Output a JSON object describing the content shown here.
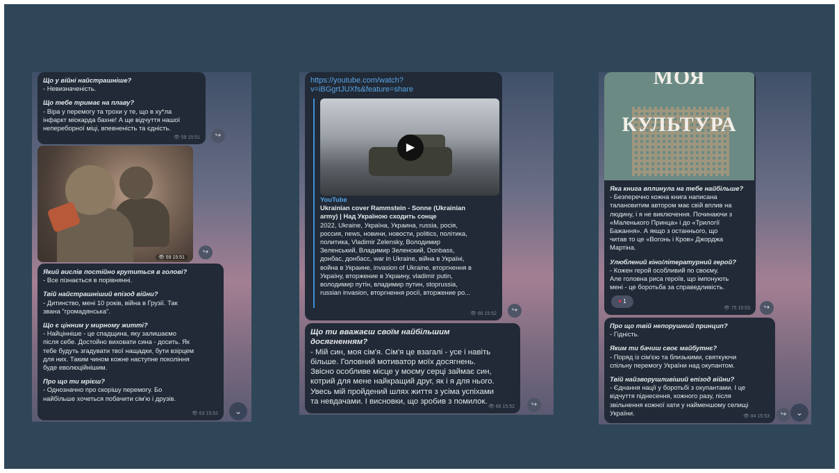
{
  "panel1": {
    "bubble1": {
      "lines": [
        {
          "q": "Що у війні найстрашніше?",
          "a": " - Невизначеність."
        },
        {
          "q": "Що тебе тримає на плаву?",
          "a": " - Віра у перемогу та трохи у те, що в ху*ла\nінфаркт міокарда бахне! А ще відчуття нашої\nнепереборної міці, впевненість та єдність."
        }
      ],
      "meta": "59 15:51"
    },
    "photo_meta": "59 15:51",
    "bubble2": {
      "lines": [
        {
          "q": "Який вислів постійно крутиться в голові?",
          "a": " - Все пізнається в порівнянні."
        },
        {
          "q": "Твій найстрашніший епізод війни?",
          "a": " - Дитинство, мені 10 років, війна в Грузії. Так\nзвана \"громадянська\"."
        },
        {
          "q": "Що є цінним у мирному житті?",
          "a": " - Найцінніше - це спадщина, яку залишаємо\nпісля себе. Достойно виховати сина - досить. Як\nтебе будуть згадувати твої нащадки, бути взірцем\nдля них. Таким чином кожне наступне покоління\nбуде еволюційнішим."
        },
        {
          "q": "Про що ти мрієш?",
          "a": " - Однозначно про скорішу перемогу. Бо\nнайбільше хочеться побачити сім'ю і друзів."
        }
      ],
      "meta": "63 15:52"
    }
  },
  "panel2": {
    "link": "https://youtube.com/watch?\nv=iBGgrtJUXfs&feature=share",
    "yt_label": "YouTube",
    "yt_title": "Ukrainian cover Rammstein - Sonne (Ukrainian\narmy) | Над Україною сходить сонце",
    "yt_desc": "2022, Ukraine, Україна, Украина, russia, росія,\nроссия, news, новини, новости, politics, політика,\nполитика, Vladimir Zelensky, Володимир\nЗеленський, Владимир Зеленский, Donbass,\nдонбас, донбасс, war in Ukraine, війна в Україні,\nвойна в Украине, invasion of Ukraine, вторгнення в\nУкраїну, вторжение в Украину, vladimir putin,\nволодимир путін, владимир путин, stoprussia,\nrussian invasion, вторгнення росії, вторжение ро...",
    "bubble1_meta": "66 15:52",
    "bubble2": {
      "q": "Що ти вважаєш своїм найбільшим\nдосягненням?",
      "a": "- Мій син, моя сім'я. Сім'я це взагалі - усе і навіть\nбільше. Головний мотиватор моїх досягнень.\nЗвісно особливе місце у моєму серці займає син,\nкотрий для мене найкращий друг, як і я для нього.\nУвесь мій пройдений шлях життя з усіма успіхами\nта невдачами. І висновки, що зробив з помилок.",
      "meta": "66 15:52"
    }
  },
  "panel3": {
    "poster_line1": "МОЯ",
    "poster_line2": "КУЛЬТУРА",
    "bubble1": {
      "lines": [
        {
          "q": "Яка книга вплинула на тебе найбільше?",
          "a": " - Безперечно кожна книга написана\nталановитим автором має свій вплив на\nлюдину, і я не виключення. Починаючи з\n«Маленького Принца» і до «Трилогії\nБажання». А якщо з останнього, що\nчитав то це «Вогонь і Кров» Джорджа\nМартіна."
        },
        {
          "q": "Улюблений кіно/літературний герой?",
          "a": " - Кожен герой особливий по своєму.\nАле головна риса героїв, що імпонують\nмені - це боротьба за справедливість."
        }
      ],
      "reaction_count": "1",
      "meta": "75 15:53"
    },
    "bubble2": {
      "lines": [
        {
          "q": "Про що твій непорушний принцип?",
          "a": " - Гідність."
        },
        {
          "q": "Яким ти бачиш своє майбутнє?",
          "a": " - Поряд із сім'єю та близькими, святкуючи\nспільну перемогу України над окупантом."
        },
        {
          "q": "Твій найзворушливіший епізод війни?",
          "a": " - Єднання нації у боротьбі з окупантами. І це\nвідчуття піднесення, кожного разу, після\nзвільнення кожної хати у найменшому селищі\nУкраїни."
        }
      ],
      "meta": "84 15:53"
    }
  },
  "icons": {
    "forward": "↪",
    "down": "⌄",
    "play": "▶",
    "eye": "👁",
    "heart": "♥"
  },
  "colors": {
    "slide_bg": "#2f4658",
    "bubble_bg": "#212a36",
    "link": "#5aa6e8",
    "reaction_heart": "#e0314a"
  }
}
